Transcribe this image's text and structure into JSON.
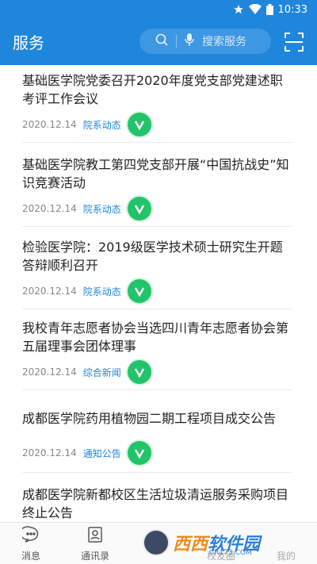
{
  "status_bar": {
    "time": "10:33",
    "icons": [
      "star-icon",
      "wifi-icon",
      "battery-icon"
    ]
  },
  "app_bar": {
    "title": "服务",
    "search_placeholder": "搜索服务",
    "icons": [
      "search-icon",
      "microphone-icon",
      "scan-icon"
    ]
  },
  "news": [
    {
      "title": "基础医学院党委召开2020年度党支部党建述职考评工作会议",
      "date": "2020.12.14",
      "category": "院系动态"
    },
    {
      "title": "基础医学院教工第四党支部开展“中国抗战史”知识竞赛活动",
      "date": "2020.12.14",
      "category": "院系动态"
    },
    {
      "title": "检验医学院：2019级医学技术硕士研究生开题答辩顺利召开",
      "date": "2020.12.14",
      "category": "院系动态"
    },
    {
      "title": "我校青年志愿者协会当选四川青年志愿者协会第五届理事会团体理事",
      "date": "2020.12.14",
      "category": "综合新闻"
    },
    {
      "title": "成都医学院药用植物园二期工程项目成交公告",
      "date": "2020.12.14",
      "category": "通知公告"
    },
    {
      "title": "成都医学院新都校区生活垃圾清运服务采购项目终止公告",
      "date": "",
      "category": ""
    }
  ],
  "bottom_nav": [
    {
      "label": "消息",
      "icon": "message-icon"
    },
    {
      "label": "通讯录",
      "icon": "contacts-icon"
    },
    {
      "label": "校友圈",
      "icon": "alumni-icon"
    },
    {
      "label": "我的",
      "icon": "profile-icon"
    }
  ],
  "watermark": {
    "text_orange": "西西",
    "text_blue": "软件园",
    "sub": "CR173.COM"
  },
  "colors": {
    "primary": "#1f86dc",
    "badge_green": "#22c46a"
  }
}
